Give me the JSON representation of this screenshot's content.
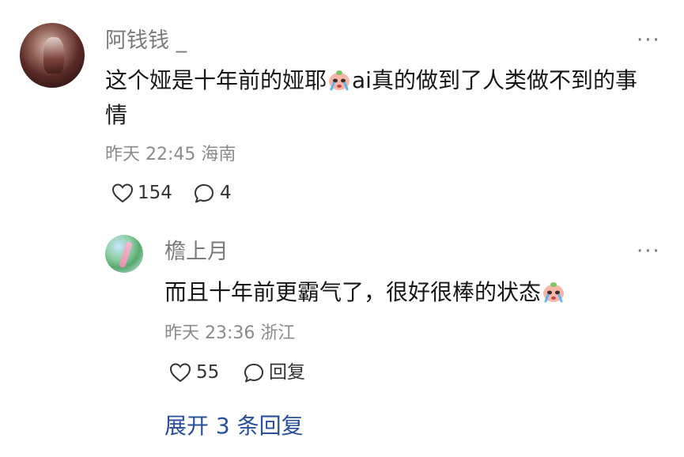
{
  "comment": {
    "username": "阿钱钱 _",
    "text_line1_part1": "这个娅是十年前的娅耶",
    "text_line1_part2": "ai真的做到了人类做不到的事",
    "text_line2": "情",
    "timestamp": "昨天 22:45",
    "location": "海南",
    "likes": "154",
    "replies": "4",
    "more_icon": "more-dots-icon",
    "emoji_icon": "crying-face-emoji"
  },
  "reply": {
    "username": "檐上月",
    "text_part1": "而且十年前更霸气了，很好很棒的状态",
    "timestamp": "昨天 23:36",
    "location": "浙江",
    "likes": "55",
    "reply_label": "回复",
    "more_icon": "more-dots-icon",
    "emoji_icon": "crying-face-emoji"
  },
  "expand": {
    "label": "展开 3 条回复"
  },
  "colors": {
    "link": "#2a4f9a",
    "secondary_text": "#8a8a8a",
    "primary_text": "#161616"
  }
}
